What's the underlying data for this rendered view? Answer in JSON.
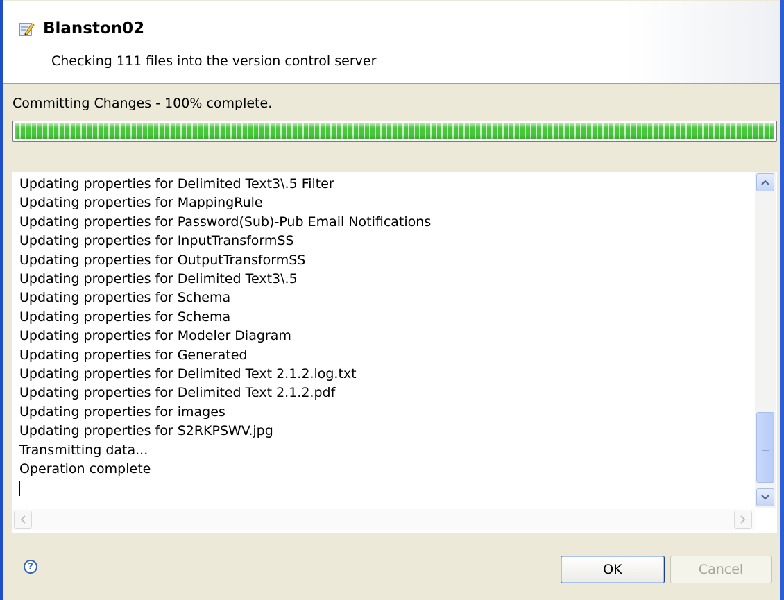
{
  "dialog": {
    "title": "Blanston02",
    "subtitle": "Checking 111 files into the version control server",
    "status_text": "Committing Changes - 100% complete.",
    "progress": 1.0
  },
  "log": {
    "lines": [
      "Updating properties for Delimited Text3\\.5 Filter",
      "Updating properties for MappingRule",
      "Updating properties for Password(Sub)-Pub Email Notifications",
      "Updating properties for InputTransformSS",
      "Updating properties for OutputTransformSS",
      "Updating properties for Delimited Text3\\.5",
      "Updating properties for Schema",
      "Updating properties for Schema",
      "Updating properties for Modeler Diagram",
      "Updating properties for Generated",
      "Updating properties for Delimited Text 2.1.2.log.txt",
      "Updating properties for Delimited Text 2.1.2.pdf",
      "Updating properties for images",
      "Updating properties for S2RKPSWV.jpg",
      "Transmitting data...",
      "Operation complete"
    ]
  },
  "buttons": {
    "ok": "OK",
    "cancel": "Cancel",
    "help": "?"
  },
  "icons": {
    "title": "edit-document-icon",
    "help": "help-icon",
    "scroll_up": "chevron-up-icon",
    "scroll_down": "chevron-down-icon",
    "scroll_left": "chevron-left-icon",
    "scroll_right": "chevron-right-icon"
  },
  "colors": {
    "progress_green": "#4ac63e",
    "frame_blue": "#1f4ec9"
  }
}
